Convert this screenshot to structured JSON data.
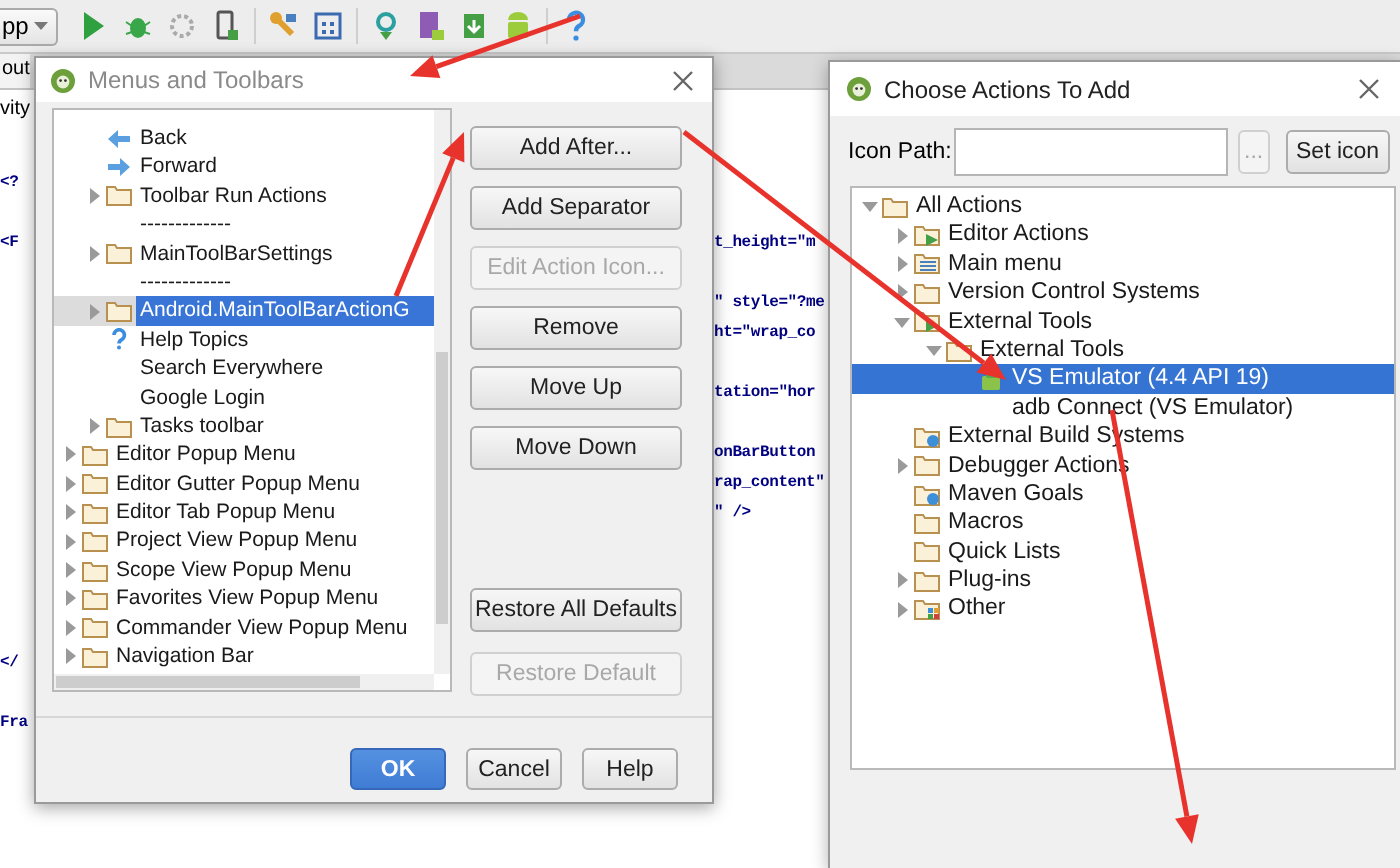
{
  "toolbar": {
    "run_config": "pp"
  },
  "editor": {
    "tab": "out",
    "file_label": "vity",
    "lines": [
      {
        "left": "<?"
      },
      {
        "left": "<F",
        "right": "t_height=\"m"
      },
      {
        "right": "\" style=\"?me"
      },
      {
        "right": "ht=\"wrap_co"
      },
      {
        "right": "tation=\"hor"
      },
      {
        "right": "onBarButton"
      },
      {
        "right": "rap_content\""
      },
      {
        "right": "\" />"
      },
      {
        "left": "</"
      },
      {
        "left": "Fra"
      }
    ]
  },
  "menus_dialog": {
    "title": "Menus and Toolbars",
    "tree": [
      {
        "children": [
          {
            "label": "Back",
            "kind": "back",
            "selected": false
          },
          {
            "label": "Forward",
            "kind": "forward",
            "selected": false
          },
          {
            "label": "Toolbar Run Actions",
            "kind": "folder",
            "expanded": false,
            "selected": false
          },
          {
            "label": "-------------",
            "kind": "separator",
            "selected": false
          },
          {
            "label": "MainToolBarSettings",
            "kind": "folder",
            "expanded": false,
            "selected": false
          },
          {
            "label": "-------------",
            "kind": "separator",
            "selected": false
          },
          {
            "label": "Android.MainToolBarActionG",
            "kind": "folder",
            "expanded": false,
            "selected": true
          },
          {
            "label": "Help Topics",
            "kind": "help",
            "selected": false
          },
          {
            "label": "Search Everywhere",
            "kind": "none",
            "selected": false
          },
          {
            "label": "Google Login",
            "kind": "none",
            "selected": false
          },
          {
            "label": "Tasks toolbar",
            "kind": "folder",
            "expanded": false,
            "selected": false
          }
        ]
      },
      {
        "label": "Editor Popup Menu",
        "kind": "folder",
        "expanded": false,
        "selected": false
      },
      {
        "label": "Editor Gutter Popup Menu",
        "kind": "folder",
        "expanded": false,
        "selected": false
      },
      {
        "label": "Editor Tab Popup Menu",
        "kind": "folder",
        "expanded": false,
        "selected": false
      },
      {
        "label": "Project View Popup Menu",
        "kind": "folder",
        "expanded": false,
        "selected": false
      },
      {
        "label": "Scope View Popup Menu",
        "kind": "folder",
        "expanded": false,
        "selected": false
      },
      {
        "label": "Favorites View Popup Menu",
        "kind": "folder",
        "expanded": false,
        "selected": false
      },
      {
        "label": "Commander View Popup Menu",
        "kind": "folder",
        "expanded": false,
        "selected": false
      },
      {
        "label": "Navigation Bar",
        "kind": "folder",
        "expanded": false,
        "selected": false
      }
    ],
    "buttons": [
      {
        "label": "Add After...",
        "disabled": false
      },
      {
        "label": "Add Separator",
        "disabled": false
      },
      {
        "label": "Edit Action Icon...",
        "disabled": true
      },
      {
        "label": "Remove",
        "disabled": false
      },
      {
        "label": "Move Up",
        "disabled": false
      },
      {
        "label": "Move Down",
        "disabled": false
      }
    ],
    "restore_buttons": [
      {
        "label": "Restore All Defaults",
        "disabled": false
      },
      {
        "label": "Restore Default",
        "disabled": true
      }
    ],
    "footer_buttons": [
      {
        "label": "OK",
        "default": true
      },
      {
        "label": "Cancel",
        "default": false
      },
      {
        "label": "Help",
        "default": false
      }
    ]
  },
  "actions_dialog": {
    "title": "Choose Actions To Add",
    "icon_path": {
      "label": "Icon Path:"
    },
    "browse_button": {
      "label": "...",
      "disabled": true
    },
    "set_icon_button": {
      "label": "Set icon",
      "disabled": false
    },
    "tree": [
      {
        "label": "All Actions",
        "kind": "folder",
        "expanded": true,
        "selected": false,
        "children": [
          {
            "label": "Editor Actions",
            "kind": "folder-green",
            "expanded": false,
            "selected": false
          },
          {
            "label": "Main menu",
            "kind": "folder-menu",
            "expanded": false,
            "selected": false
          },
          {
            "label": "Version Control Systems",
            "kind": "folder",
            "expanded": false,
            "selected": false
          },
          {
            "label": "External Tools",
            "kind": "folder-green",
            "expanded": true,
            "selected": false,
            "children": [
              {
                "label": "External Tools",
                "kind": "folder",
                "expanded": true,
                "selected": false,
                "children": [
                  {
                    "label": "VS Emulator (4.4 API 19)",
                    "kind": "device",
                    "selected": true
                  },
                  {
                    "label": "adb Connect (VS Emulator)",
                    "kind": "none",
                    "selected": false
                  }
                ]
              }
            ]
          },
          {
            "label": "External Build Systems",
            "kind": "folder-badge",
            "selected": false
          },
          {
            "label": "Debugger Actions",
            "kind": "folder",
            "expanded": false,
            "selected": false
          },
          {
            "label": "Maven Goals",
            "kind": "folder-badge",
            "selected": false
          },
          {
            "label": "Macros",
            "kind": "folder",
            "selected": false
          },
          {
            "label": "Quick Lists",
            "kind": "folder",
            "selected": false
          },
          {
            "label": "Plug-ins",
            "kind": "folder",
            "expanded": false,
            "selected": false
          },
          {
            "label": "Other",
            "kind": "folder-grid",
            "expanded": false,
            "selected": false
          }
        ]
      }
    ]
  }
}
